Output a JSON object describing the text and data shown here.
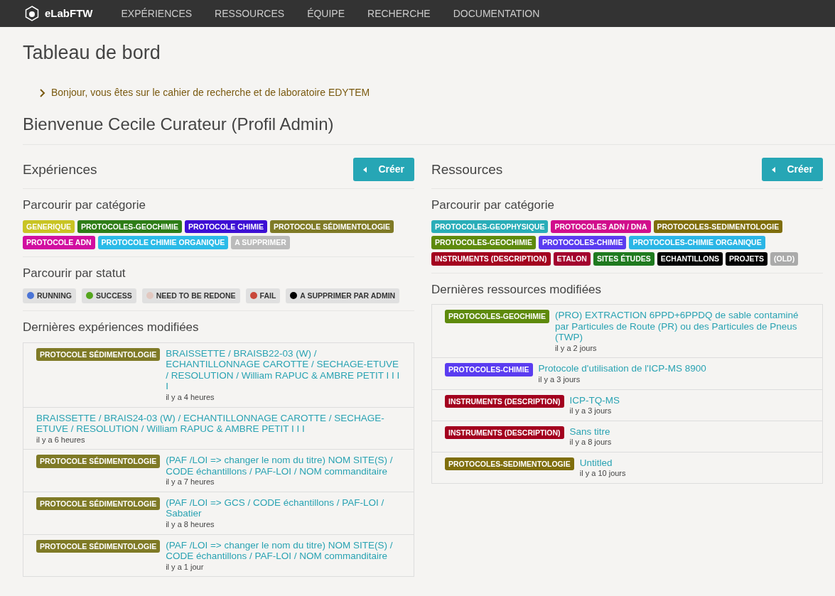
{
  "navbar": {
    "brand": "eLabFTW",
    "links": [
      "EXPÉRIENCES",
      "RESSOURCES",
      "ÉQUIPE",
      "RECHERCHE",
      "DOCUMENTATION"
    ]
  },
  "page_title": "Tableau de bord",
  "notice": "Bonjour, vous êtes sur le cahier de recherche et de laboratoire EDYTEM",
  "welcome": "Bienvenue Cecile Curateur (Profil Admin)",
  "experiments": {
    "title": "Expériences",
    "create_button": "Créer",
    "categories_title": "Parcourir par catégorie",
    "categories": [
      {
        "label": "GENERIQUE",
        "color": "#c9c424"
      },
      {
        "label": "PROTOCOLES-GEOCHIMIE",
        "color": "#2e7d17"
      },
      {
        "label": "PROTOCOLE CHIMIE",
        "color": "#3d0fd4"
      },
      {
        "label": "PROTOCOLE SÉDIMENTOLOGIE",
        "color": "#7f7a26"
      },
      {
        "label": "PROTOCOLE ADN",
        "color": "#d10ea0"
      },
      {
        "label": "PROTOCOLE CHIMIE ORGANIQUE",
        "color": "#2bbbe8"
      },
      {
        "label": "A SUPPRIMER",
        "color": "#bbbbbb"
      }
    ],
    "status_title": "Parcourir par statut",
    "statuses": [
      {
        "label": "RUNNING",
        "color": "#4a74d6"
      },
      {
        "label": "SUCCESS",
        "color": "#54a51d"
      },
      {
        "label": "NEED TO BE REDONE",
        "color": "#e2c8c0"
      },
      {
        "label": "FAIL",
        "color": "#c9473a"
      },
      {
        "label": "A SUPPRIMER PAR ADMIN",
        "color": "#000000"
      }
    ],
    "recent_title": "Dernières expériences modifiées",
    "recent": [
      {
        "category": "PROTOCOLE SÉDIMENTOLOGIE",
        "color": "#7f7a26",
        "title": "BRAISSETTE / BRAISB22-03 (W) / ECHANTILLONNAGE CAROTTE / SECHAGE-ETUVE / RESOLUTION / William RAPUC & AMBRE PETIT I I I I",
        "time": "il y a 4 heures"
      },
      {
        "title": "BRAISSETTE / BRAIS24-03 (W) / ECHANTILLONNAGE CAROTTE / SECHAGE-ETUVE / RESOLUTION / William RAPUC & AMBRE PETIT I I I",
        "time": "il y a 6 heures"
      },
      {
        "category": "PROTOCOLE SÉDIMENTOLOGIE",
        "color": "#7f7a26",
        "title": "(PAF /LOI => changer le nom du titre) NOM SITE(S) / CODE échantillons / PAF-LOI / NOM commanditaire",
        "time": "il y a 7 heures"
      },
      {
        "category": "PROTOCOLE SÉDIMENTOLOGIE",
        "color": "#7f7a26",
        "title": "(PAF /LOI => GCS / CODE échantillons / PAF-LOI / Sabatier",
        "time": "il y a 8 heures"
      },
      {
        "category": "PROTOCOLE SÉDIMENTOLOGIE",
        "color": "#7f7a26",
        "title": "(PAF /LOI => changer le nom du titre) NOM SITE(S) / CODE échantillons / PAF-LOI / NOM commanditaire",
        "time": "il y a 1 jour"
      }
    ]
  },
  "resources": {
    "title": "Ressources",
    "create_button": "Créer",
    "categories_title": "Parcourir par catégorie",
    "categories": [
      {
        "label": "PROTOCOLES-GEOPHYSIQUE",
        "color": "#29adb8"
      },
      {
        "label": "PROTOCOLES ADN / DNA",
        "color": "#d10e8c"
      },
      {
        "label": "PROTOCOLES-SEDIMENTOLOGIE",
        "color": "#7f6e0c"
      },
      {
        "label": "PROTOCOLES-GEOCHIMIE",
        "color": "#5e8a0c"
      },
      {
        "label": "PROTOCOLES-CHIMIE",
        "color": "#5a3cf0"
      },
      {
        "label": "PROTOCOLES-CHIMIE ORGANIQUE",
        "color": "#2bb6e6"
      },
      {
        "label": "INSTRUMENTS (DESCRIPTION)",
        "color": "#a3001e"
      },
      {
        "label": "ETALON",
        "color": "#a3002e"
      },
      {
        "label": "SITES ÉTUDES",
        "color": "#1f7a1f"
      },
      {
        "label": "ECHANTILLONS",
        "color": "#000000"
      },
      {
        "label": "PROJETS",
        "color": "#000001"
      },
      {
        "label": "(OLD)",
        "color": "#aaaaaa"
      }
    ],
    "recent_title": "Dernières ressources modifiées",
    "recent": [
      {
        "category": "PROTOCOLES-GEOCHIMIE",
        "color": "#5e8a0c",
        "title": "(PRO) EXTRACTION 6PPD+6PPDQ de sable contaminé par Particules de Route (PR) ou des Particules de Pneus (TWP)",
        "time": "il y a 2 jours"
      },
      {
        "category": "PROTOCOLES-CHIMIE",
        "color": "#5a3cf0",
        "title": "Protocole d'utilisation de l'ICP-MS 8900",
        "time": "il y a 3 jours"
      },
      {
        "category": "INSTRUMENTS (DESCRIPTION)",
        "color": "#a3001e",
        "title": "ICP-TQ-MS",
        "time": "il y a 3 jours"
      },
      {
        "category": "INSTRUMENTS (DESCRIPTION)",
        "color": "#a3001e",
        "title": "Sans titre",
        "time": "il y a 8 jours"
      },
      {
        "category": "PROTOCOLES-SEDIMENTOLOGIE",
        "color": "#7f6e0c",
        "title": "Untitled",
        "time": "il y a 10 jours"
      }
    ]
  }
}
